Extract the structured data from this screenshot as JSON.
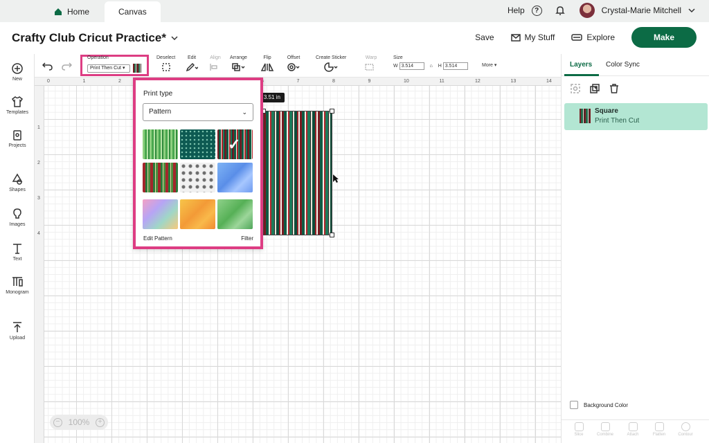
{
  "tabs": {
    "home": "Home",
    "canvas": "Canvas"
  },
  "top_right": {
    "help": "Help",
    "user_name": "Crystal-Marie Mitchell"
  },
  "project": {
    "title": "Crafty Club Cricut Practice*"
  },
  "header": {
    "save": "Save",
    "my_stuff": "My Stuff",
    "explore": "Explore",
    "make": "Make"
  },
  "sidebar": {
    "new": "New",
    "templates": "Templates",
    "projects": "Projects",
    "shapes": "Shapes",
    "images": "Images",
    "text": "Text",
    "monogram": "Monogram",
    "upload": "Upload"
  },
  "toolbar": {
    "operation_label": "Operation",
    "operation_value": "Print Then Cut",
    "deselect": "Deselect",
    "edit": "Edit",
    "align": "Align",
    "arrange": "Arrange",
    "flip": "Flip",
    "offset": "Offset",
    "create_sticker": "Create Sticker",
    "warp": "Warp",
    "size": "Size",
    "w_label": "W",
    "w_value": "3.514",
    "h_label": "H",
    "h_value": "3.514",
    "more": "More"
  },
  "ruler": {
    "top_ticks": [
      "0",
      "1",
      "2",
      "3",
      "4",
      "5",
      "6",
      "7",
      "8",
      "9",
      "10",
      "11",
      "12",
      "13",
      "14"
    ],
    "left_ticks": [
      "1",
      "2",
      "3",
      "4"
    ]
  },
  "canvas": {
    "dimension_tag": "n x 3.51 in"
  },
  "pattern_popup": {
    "title": "Print type",
    "selected_type": "Pattern",
    "patterns": [
      {
        "name": "green-stripes-pattern",
        "selected": false
      },
      {
        "name": "teal-dots-pattern",
        "selected": false
      },
      {
        "name": "serape-stripes-pattern",
        "selected": true
      },
      {
        "name": "plaid-stripes-pattern",
        "selected": false
      },
      {
        "name": "ornament-pattern",
        "selected": false
      },
      {
        "name": "blue-watercolor-pattern",
        "selected": false
      },
      {
        "name": "pastel-watercolor-pattern",
        "selected": false
      },
      {
        "name": "orange-watercolor-pattern",
        "selected": false
      },
      {
        "name": "green-watercolor-pattern",
        "selected": false
      }
    ],
    "edit_pattern": "Edit Pattern",
    "filter": "Filter"
  },
  "zoom": {
    "level": "100%"
  },
  "right_panel": {
    "tab_layers": "Layers",
    "tab_color_sync": "Color Sync",
    "layer_name": "Square",
    "layer_operation": "Print Then Cut",
    "background_color": "Background Color",
    "bottom_tools": [
      "Slice",
      "Combine",
      "Attach",
      "Flatten",
      "Contour"
    ]
  },
  "colors": {
    "brand_green": "#0c6b45",
    "highlight_pink": "#dd3d83",
    "layer_selected_bg": "#b3e6d3"
  }
}
